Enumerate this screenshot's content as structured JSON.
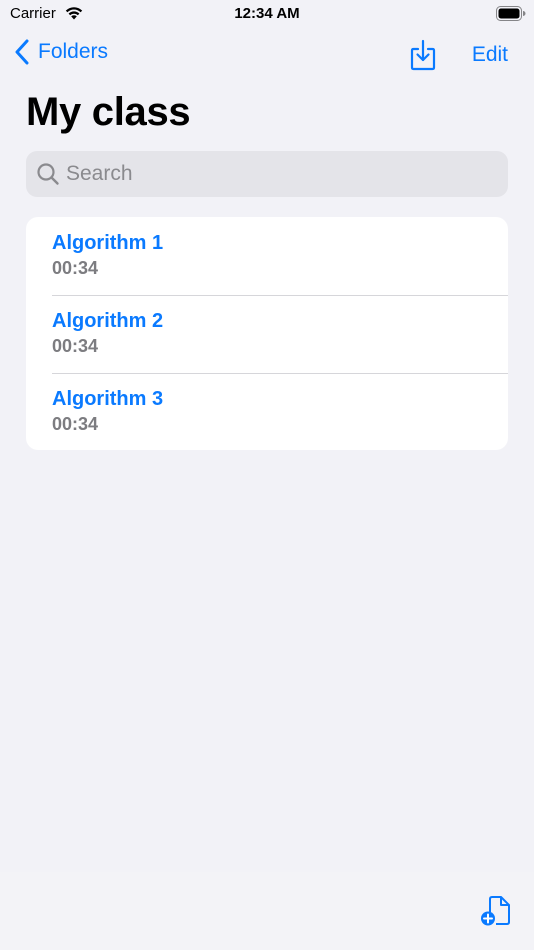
{
  "status_bar": {
    "carrier": "Carrier",
    "time": "12:34 AM",
    "icons": [
      "wifi-icon",
      "battery-icon"
    ]
  },
  "nav": {
    "back_label": "Folders",
    "back_icon": "chevron-left-icon",
    "download_icon": "tray-arrow-down-icon",
    "edit_label": "Edit"
  },
  "page": {
    "title": "My class"
  },
  "search": {
    "placeholder": "Search",
    "icon": "magnifying-glass-icon"
  },
  "items": [
    {
      "title": "Algorithm 1",
      "subtitle": "00:34"
    },
    {
      "title": "Algorithm 2",
      "subtitle": "00:34"
    },
    {
      "title": "Algorithm 3",
      "subtitle": "00:34"
    }
  ],
  "toolbar": {
    "compose_icon": "new-document-icon"
  },
  "colors": {
    "accent": "#0A7AFF",
    "background": "#F2F2F7",
    "card": "#FFFFFF",
    "search_fill": "#E4E4E9",
    "secondary_text": "#7C7C80"
  }
}
